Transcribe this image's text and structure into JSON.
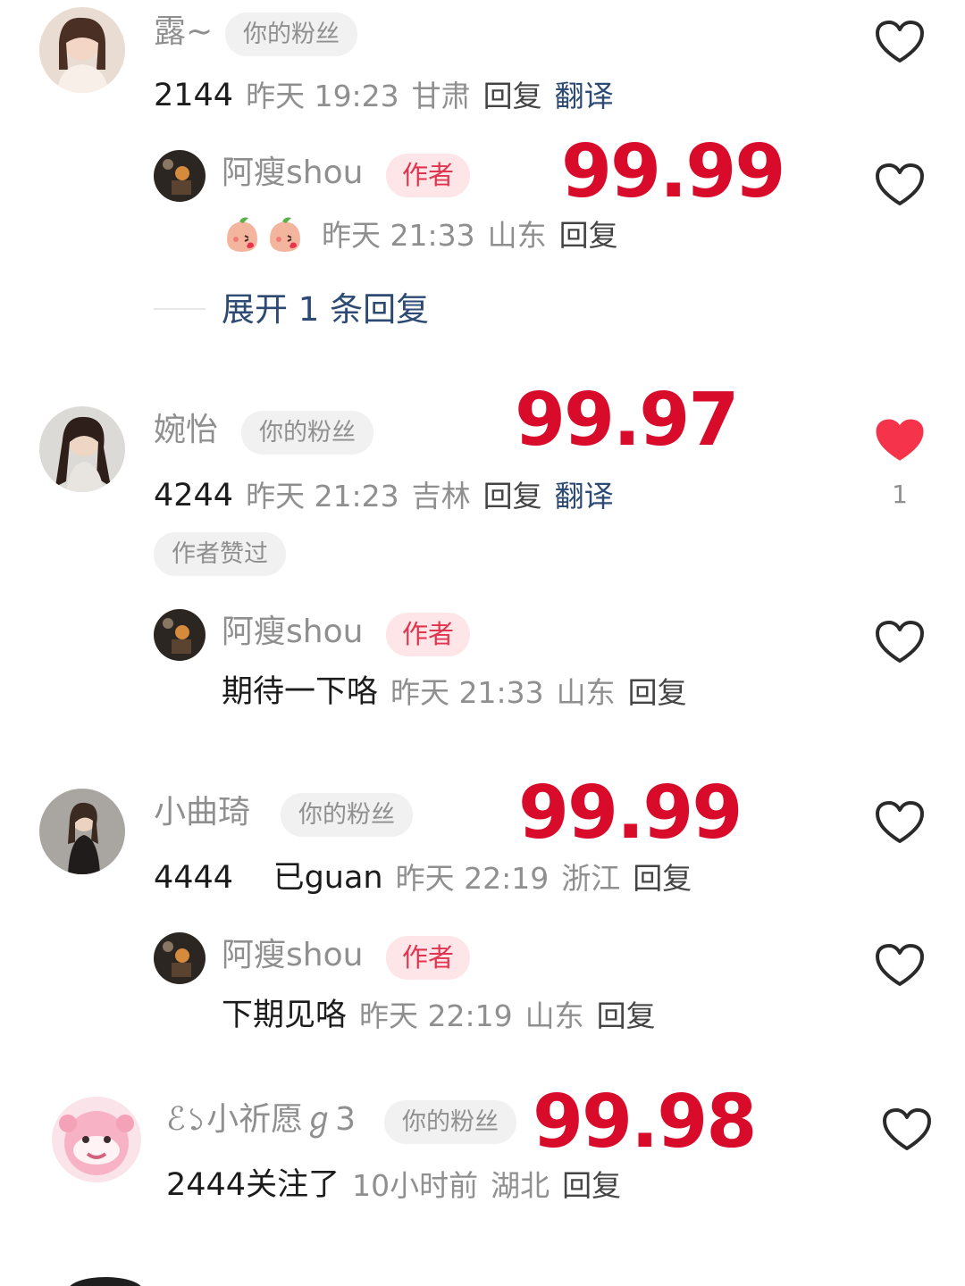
{
  "comments": [
    {
      "name": "露~",
      "badge": "你的粉丝",
      "content": "2144",
      "time": "昨天 19:23",
      "location": "甘肃",
      "reply_label": "回复",
      "translate_label": "翻译",
      "score": "99.99",
      "reply": {
        "name": "阿瘦shou",
        "badge": "作者",
        "time": "昨天 21:33",
        "location": "山东",
        "reply_label": "回复"
      },
      "expand_label": "展开 1 条回复"
    },
    {
      "name": "婉怡",
      "badge": "你的粉丝",
      "content": "4244",
      "time": "昨天 21:23",
      "location": "吉林",
      "reply_label": "回复",
      "translate_label": "翻译",
      "score": "99.97",
      "liked_by_author": "作者赞过",
      "like_count": "1",
      "reply": {
        "name": "阿瘦shou",
        "badge": "作者",
        "content": "期待一下咯",
        "time": "昨天 21:33",
        "location": "山东",
        "reply_label": "回复"
      }
    },
    {
      "name": "小曲琦",
      "badge": "你的粉丝",
      "content": "4444    已guan",
      "time": "昨天 22:19",
      "location": "浙江",
      "reply_label": "回复",
      "score": "99.99",
      "reply": {
        "name": "阿瘦shou",
        "badge": "作者",
        "content": "下期见咯",
        "time": "昨天 22:19",
        "location": "山东",
        "reply_label": "回复"
      }
    },
    {
      "name": "ℰ১小祈愿ℊ3",
      "badge": "你的粉丝",
      "content": "2444关注了",
      "time": "10小时前",
      "location": "湖北",
      "reply_label": "回复",
      "score": "99.98"
    }
  ],
  "colors": {
    "score_red": "#d80c2a",
    "like_red": "#f5334a",
    "link_blue": "#2c4a73"
  },
  "icons": {
    "like": "heart-outline-icon",
    "liked": "heart-filled-icon",
    "emoji": "peach-kiss-emoji"
  }
}
